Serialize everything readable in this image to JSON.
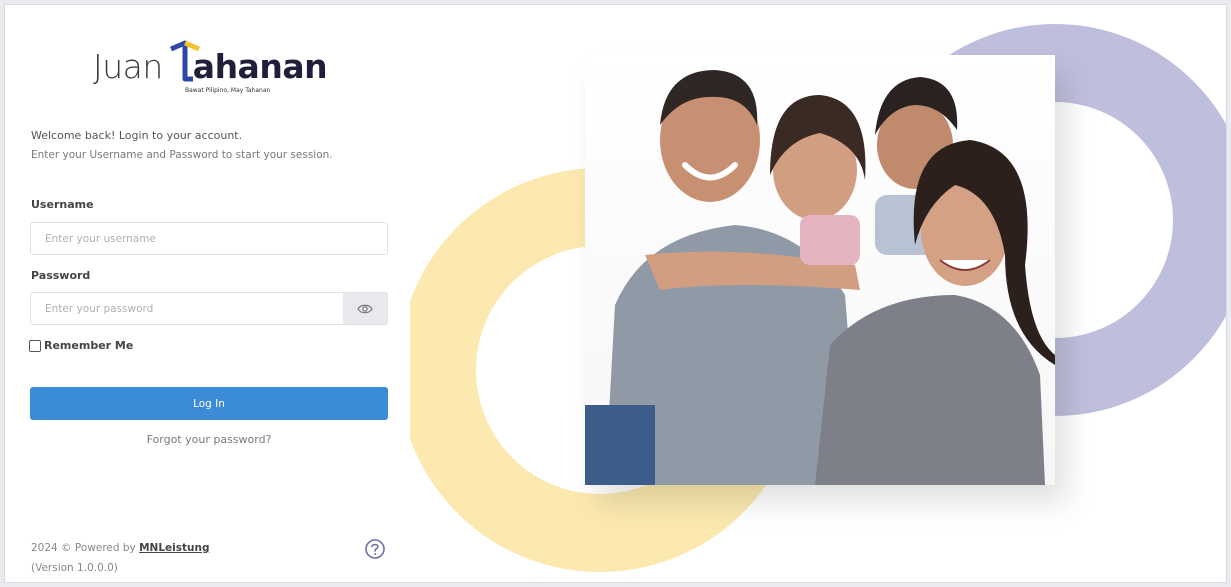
{
  "brand": {
    "logo_part1": "Juan",
    "logo_part2": "ahanan",
    "tagline": "Bawat Pilipino, May Tahanan",
    "accent_blue": "#2d47a6",
    "accent_yellow": "#f2c230"
  },
  "login": {
    "welcome": "Welcome back! Login to your account.",
    "instructions": "Enter your Username and Password to start your session.",
    "username_label": "Username",
    "username_placeholder": "Enter your username",
    "password_label": "Password",
    "password_placeholder": "Enter your password",
    "remember_label": "Remember Me",
    "login_button": "Log In",
    "forgot_link": "Forgot your password?",
    "button_color": "#3b8bd9"
  },
  "footer": {
    "copyright": "2024 © Powered by",
    "company": "MNLeistung",
    "version": "(Version 1.0.0.0)"
  },
  "hero": {
    "ring_yellow": "#fbe9b0",
    "ring_purple": "#bebfdc",
    "image": "family-photo"
  }
}
